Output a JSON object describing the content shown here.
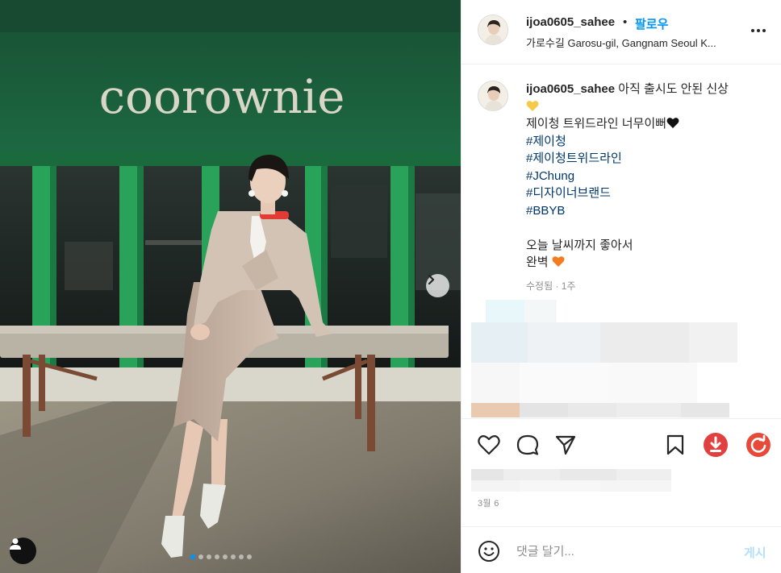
{
  "post": {
    "photo": {
      "sign_text": "coorownie",
      "carousel": {
        "total_slides": 8,
        "active_index": 0
      },
      "next_icon": "chevron-right-icon",
      "user_tag_icon": "person-icon"
    },
    "header": {
      "username": "ijoa0605_sahee",
      "separator": "•",
      "follow_label": "팔로우",
      "location": "가로수길 Garosu-gil, Gangnam Seoul K...",
      "more_icon": "more-horizontal-icon"
    },
    "caption": {
      "username": "ijoa0605_sahee",
      "text_line1": " 아직 출시도 안된 신상",
      "emoji1": "yellow-heart-icon",
      "line2": "제이청 트위드라인 너무이뻐",
      "emoji2": "black-heart-icon",
      "hashtags": [
        "#제이청",
        "#제이청트위드라인",
        "#JChung",
        "#디자이너브랜드",
        "#BBYB"
      ],
      "line3": "오늘 날씨까지 좋아서",
      "line4": "완벽",
      "emoji3": "orange-heart-icon",
      "meta": "수정됨 · 1주"
    },
    "actions": {
      "like_icon": "heart-outline-icon",
      "comment_icon": "comment-icon",
      "share_icon": "send-icon",
      "save_icon": "bookmark-icon",
      "download_icon": "download-icon",
      "refresh_icon": "refresh-icon",
      "download_color": "#e0403f",
      "refresh_color": "#e84a3a"
    },
    "date": "3월 6",
    "comment": {
      "emoji_icon": "smiley-icon",
      "placeholder": "댓글 달기...",
      "post_label": "게시"
    }
  },
  "colors": {
    "link_blue": "#0095f6",
    "hashtag": "#00376b",
    "muted": "#8e8e8e",
    "post_disabled": "#b2dffc",
    "sign_green": "#1c5c3c"
  }
}
